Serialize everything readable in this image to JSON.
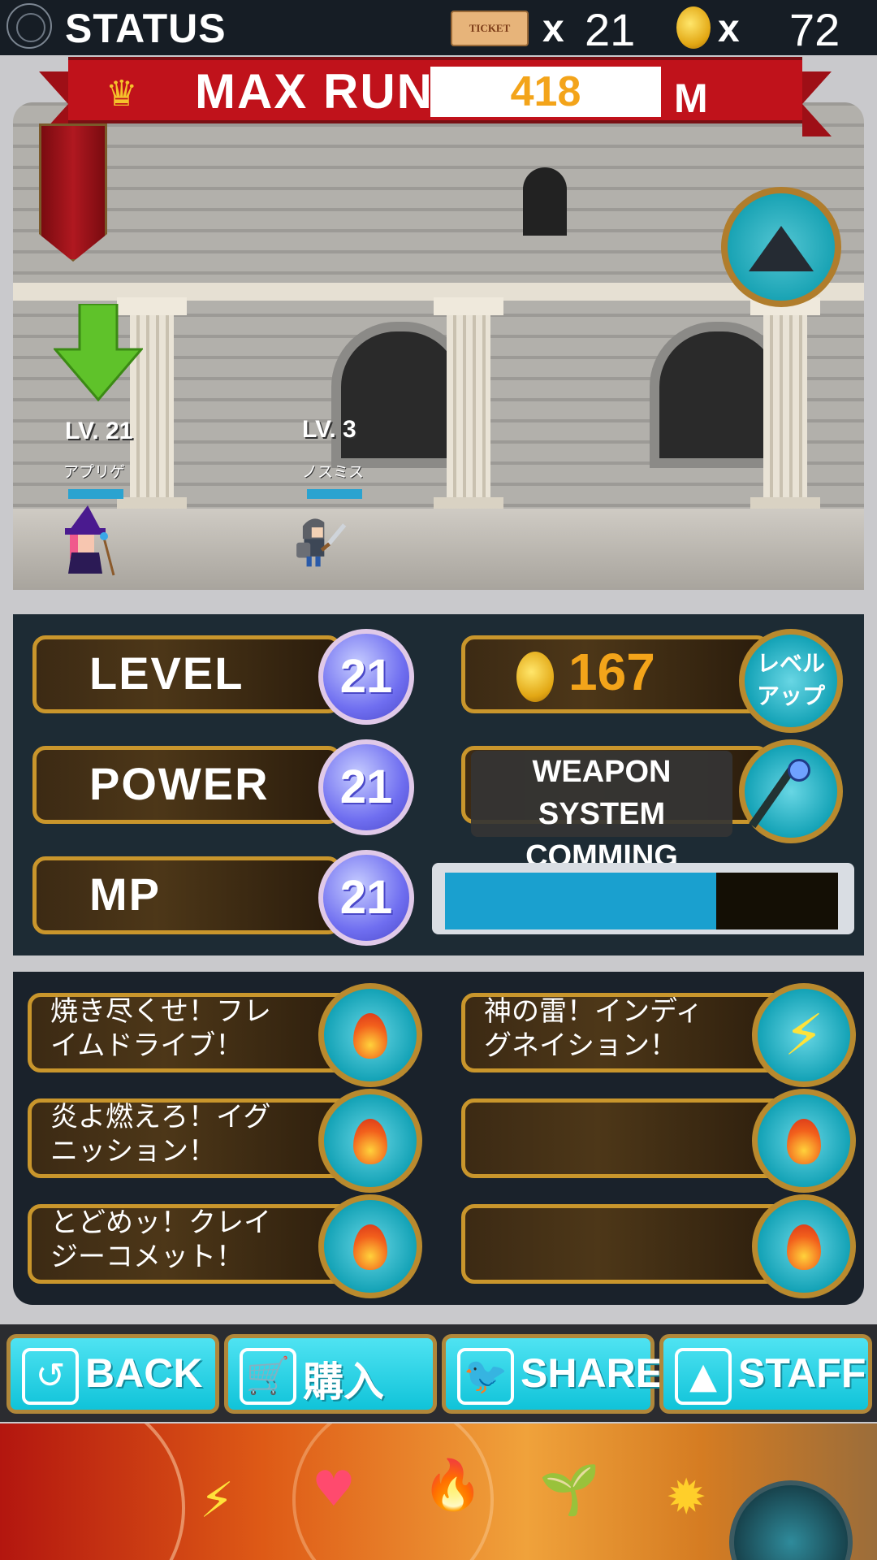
{
  "topbar": {
    "title": "STATUS",
    "ticket_label": "TICKET",
    "multiply": "x",
    "ticket_count": "21",
    "coin_count": "72"
  },
  "maxrun": {
    "label": "MAX RUN",
    "value": "418",
    "unit": "M"
  },
  "characters": [
    {
      "level": "LV. 21",
      "name": "アプリゲ",
      "selected": true
    },
    {
      "level": "LV. 3",
      "name": "ノスミス",
      "selected": false
    }
  ],
  "stats": {
    "level": {
      "label": "LEVEL",
      "value": "21"
    },
    "power": {
      "label": "POWER",
      "value": "21"
    },
    "mp": {
      "label": "MP",
      "value": "21",
      "fill": 0.69
    }
  },
  "levelup": {
    "cost": "167",
    "button_label_line1": "レベル",
    "button_label_line2": "アップ"
  },
  "weapon": {
    "notice_line1": "WEAPON SYSTEM",
    "notice_line2": "COMMING SOON!"
  },
  "skills": [
    {
      "line1": "焼き尽くせ！フレ",
      "line2": "イムドライブ！",
      "icon": "fire-icon"
    },
    {
      "line1": "神の雷！インディ",
      "line2": "グネイション！",
      "icon": "lightning-icon"
    },
    {
      "line1": "炎よ燃えろ！イグ",
      "line2": "ニッション！",
      "icon": "fire-icon"
    },
    {
      "line1": "",
      "line2": "",
      "icon": "fire-icon"
    },
    {
      "line1": "とどめッ！クレイ",
      "line2": "ジーコメット！",
      "icon": "fire-icon"
    },
    {
      "line1": "",
      "line2": "",
      "icon": "fire-icon"
    }
  ],
  "nav": {
    "back": "BACK",
    "buy": "購入",
    "share": "SHARE",
    "staff": "STAFF"
  },
  "colors": {
    "accent_teal": "#13b7cc",
    "banner_red": "#c0121b",
    "gold": "#c9962c",
    "orb_purple": "#6f6ef0",
    "coin_gold": "#f3a41a"
  }
}
